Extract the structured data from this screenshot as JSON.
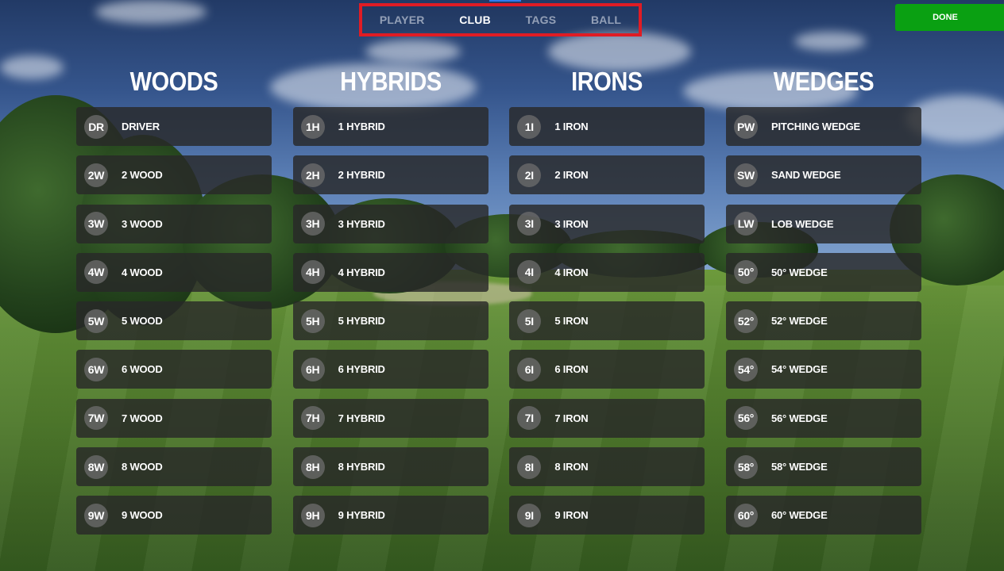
{
  "tabs": [
    {
      "label": "PLAYER",
      "active": false
    },
    {
      "label": "CLUB",
      "active": true
    },
    {
      "label": "TAGS",
      "active": false
    },
    {
      "label": "BALL",
      "active": false
    }
  ],
  "done_label": "DONE",
  "columns": [
    {
      "title": "WOODS",
      "clubs": [
        {
          "badge": "DR",
          "name": "DRIVER"
        },
        {
          "badge": "2W",
          "name": "2 WOOD"
        },
        {
          "badge": "3W",
          "name": "3 WOOD"
        },
        {
          "badge": "4W",
          "name": "4 WOOD"
        },
        {
          "badge": "5W",
          "name": "5 WOOD"
        },
        {
          "badge": "6W",
          "name": "6 WOOD"
        },
        {
          "badge": "7W",
          "name": "7 WOOD"
        },
        {
          "badge": "8W",
          "name": "8 WOOD"
        },
        {
          "badge": "9W",
          "name": "9 WOOD"
        }
      ]
    },
    {
      "title": "HYBRIDS",
      "clubs": [
        {
          "badge": "1H",
          "name": "1 HYBRID"
        },
        {
          "badge": "2H",
          "name": "2 HYBRID"
        },
        {
          "badge": "3H",
          "name": "3 HYBRID"
        },
        {
          "badge": "4H",
          "name": "4 HYBRID"
        },
        {
          "badge": "5H",
          "name": "5 HYBRID"
        },
        {
          "badge": "6H",
          "name": "6 HYBRID"
        },
        {
          "badge": "7H",
          "name": "7 HYBRID"
        },
        {
          "badge": "8H",
          "name": "8 HYBRID"
        },
        {
          "badge": "9H",
          "name": "9 HYBRID"
        }
      ]
    },
    {
      "title": "IRONS",
      "clubs": [
        {
          "badge": "1I",
          "name": "1 IRON"
        },
        {
          "badge": "2I",
          "name": "2 IRON"
        },
        {
          "badge": "3I",
          "name": "3 IRON"
        },
        {
          "badge": "4I",
          "name": "4 IRON"
        },
        {
          "badge": "5I",
          "name": "5 IRON"
        },
        {
          "badge": "6I",
          "name": "6 IRON"
        },
        {
          "badge": "7I",
          "name": "7 IRON"
        },
        {
          "badge": "8I",
          "name": "8 IRON"
        },
        {
          "badge": "9I",
          "name": "9 IRON"
        }
      ]
    },
    {
      "title": "WEDGES",
      "clubs": [
        {
          "badge": "PW",
          "name": "PITCHING WEDGE"
        },
        {
          "badge": "SW",
          "name": "SAND WEDGE"
        },
        {
          "badge": "LW",
          "name": "LOB WEDGE"
        },
        {
          "badge": "50°",
          "name": "50° WEDGE"
        },
        {
          "badge": "52°",
          "name": "52° WEDGE"
        },
        {
          "badge": "54°",
          "name": "54° WEDGE"
        },
        {
          "badge": "56°",
          "name": "56° WEDGE"
        },
        {
          "badge": "58°",
          "name": "58° WEDGE"
        },
        {
          "badge": "60°",
          "name": "60° WEDGE"
        }
      ]
    }
  ],
  "colors": {
    "done_button": "#0aa012",
    "tab_highlight_border": "#e01c24",
    "card_background": "#282828",
    "badge_background": "#6e6e6e"
  }
}
